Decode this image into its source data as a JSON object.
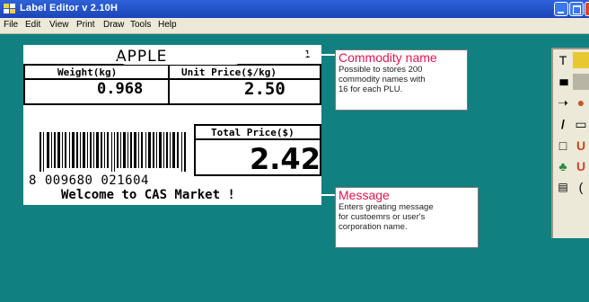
{
  "window": {
    "title": "Label Editor v 2.10H"
  },
  "menu": [
    "File",
    "Edit",
    "View",
    "Print",
    "Draw",
    "Tools",
    "Help"
  ],
  "label": {
    "commodity": "APPLE",
    "plu_number": "1",
    "weight_header": "Weight(kg)",
    "unit_price_header": "Unit Price($/kg)",
    "weight_value": "0.968",
    "unit_price_value": "2.50",
    "total_header": "Total Price($)",
    "total_value": "2.42",
    "barcode_number": "8 009680 021604",
    "message": "Welcome to CAS Market !"
  },
  "callouts": {
    "commodity": {
      "title": "Commodity name",
      "desc": [
        "Possible to stores 200",
        "commodity names with",
        "16 for each PLU."
      ]
    },
    "message": {
      "title": "Message",
      "desc": [
        "Enters greating message",
        "for custoemrs or user's",
        "corporation name."
      ]
    }
  },
  "tools": [
    {
      "icon": "text-tool-icon",
      "glyph": "T"
    },
    {
      "icon": "barcode-tool-icon",
      "glyph": "▮▮▮"
    },
    {
      "icon": "arrow-tool-icon",
      "glyph": "➝"
    },
    {
      "icon": "line-tool-icon",
      "glyph": "/"
    },
    {
      "icon": "rectangle-tool-icon",
      "glyph": "□"
    },
    {
      "icon": "image-tool-icon",
      "glyph": "♣"
    },
    {
      "icon": "field-tool-icon",
      "glyph": "▤"
    }
  ],
  "colors": {
    "desktop": "#118080",
    "titlebar": "#2556cf",
    "callout_title": "#e2154e"
  }
}
